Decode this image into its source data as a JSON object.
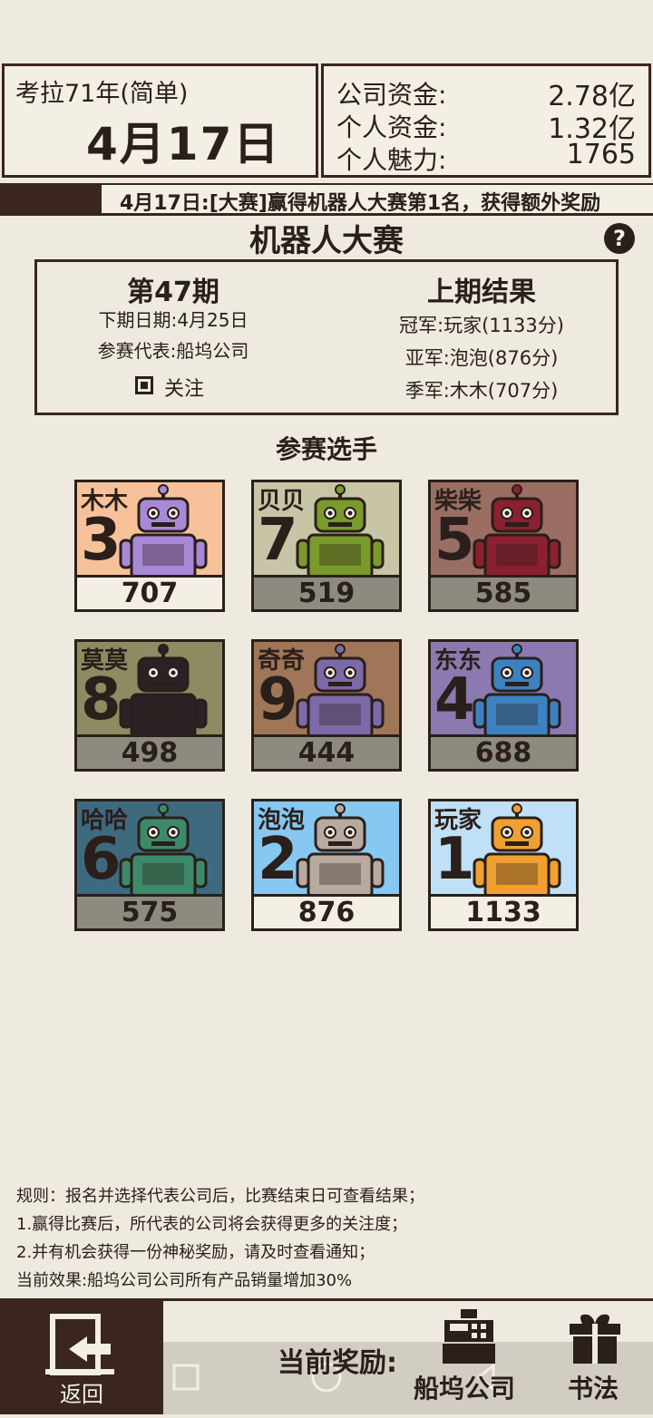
{
  "header": {
    "year_label": "考拉71年(简单)",
    "date": "4月17日",
    "stats": [
      {
        "label": "公司资金:",
        "value": "2.78亿"
      },
      {
        "label": "个人资金:",
        "value": "1.32亿"
      },
      {
        "label": "个人魅力:",
        "value": "1765"
      }
    ]
  },
  "ticker": "4月17日:[大赛]赢得机器人大赛第1名，获得额外奖励",
  "title": "机器人大赛",
  "help_icon": "?",
  "info": {
    "period": "第47期",
    "next_date": "下期日期:4月25日",
    "representative": "参赛代表:船坞公司",
    "follow_label": "关注",
    "last_title": "上期结果",
    "results": [
      "冠军:玩家(1133分)",
      "亚军:泡泡(876分)",
      "季军:木木(707分)"
    ]
  },
  "contestants_label": "参赛选手",
  "contestants": [
    {
      "name": "木木",
      "rank": "3",
      "score": "707",
      "bg": "#f7c29a",
      "robot": "#a988d8",
      "score_bg": "#f4efe4"
    },
    {
      "name": "贝贝",
      "rank": "7",
      "score": "519",
      "bg": "#c8c4a6",
      "robot": "#7a9a2c",
      "score_bg": "#8d8a80"
    },
    {
      "name": "柴柴",
      "rank": "5",
      "score": "585",
      "bg": "#9a6e62",
      "robot": "#8a2030",
      "score_bg": "#8d8a80"
    },
    {
      "name": "莫莫",
      "rank": "8",
      "score": "498",
      "bg": "#8e8b63",
      "robot": "#2a2226",
      "score_bg": "#8d8a80"
    },
    {
      "name": "奇奇",
      "rank": "9",
      "score": "444",
      "bg": "#a07658",
      "robot": "#7c6aa8",
      "score_bg": "#8d8a80"
    },
    {
      "name": "东东",
      "rank": "4",
      "score": "688",
      "bg": "#8a7ab0",
      "robot": "#3d82c0",
      "score_bg": "#8d8a80"
    },
    {
      "name": "哈哈",
      "rank": "6",
      "score": "575",
      "bg": "#3e6a80",
      "robot": "#3d8a6a",
      "score_bg": "#8d8a80"
    },
    {
      "name": "泡泡",
      "rank": "2",
      "score": "876",
      "bg": "#86c8f2",
      "robot": "#b8aaa0",
      "score_bg": "#f4efe4"
    },
    {
      "name": "玩家",
      "rank": "1",
      "score": "1133",
      "bg": "#bfe0f6",
      "robot": "#f0a030",
      "score_bg": "#f4efe4"
    }
  ],
  "rules": [
    "规则：报名并选择代表公司后，比赛结束日可查看结果；",
    "1.赢得比赛后，所代表的公司将会获得更多的关注度；",
    "2.并有机会获得一份神秘奖励，请及时查看通知；",
    "当前效果:船坞公司公司所有产品销量增加30%"
  ],
  "bottom": {
    "back_label": "返回",
    "reward_label": "当前奖励:",
    "rewards": [
      "船坞公司",
      "书法"
    ]
  }
}
